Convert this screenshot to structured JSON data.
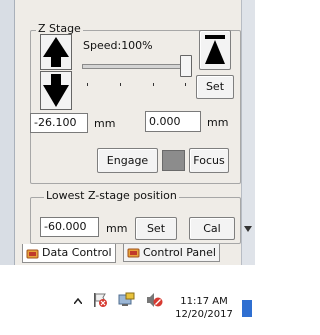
{
  "z_stage": {
    "title": "Z Stage",
    "speed_label": "Speed:100%",
    "speed_percent": 100,
    "set_label": "Set",
    "position_value": "-26.100",
    "position_unit": "mm",
    "target_value": "0.000",
    "target_unit": "mm",
    "engage_label": "Engage",
    "focus_label": "Focus",
    "up_icon": "arrow-up-icon",
    "down_icon": "arrow-down-icon",
    "top_icon": "move-to-top-icon"
  },
  "lowest_position": {
    "title": "Lowest Z-stage position",
    "value": "-60.000",
    "unit": "mm",
    "set_label": "Set",
    "cal_label": "Cal"
  },
  "tabs": [
    {
      "label": "Data Control",
      "icon": "data-control-icon",
      "active": true
    },
    {
      "label": "Control Panel",
      "icon": "control-panel-icon",
      "active": false
    }
  ],
  "taskbar": {
    "time": "11:17 AM",
    "date": "12/20/2017",
    "icons": [
      "chevron-up-icon",
      "flag-icon",
      "network-icon",
      "volume-muted-icon",
      "show-desktop-icon"
    ]
  },
  "colors": {
    "panel_bg": "#efece7",
    "indicator_gray": "#8c8c8c",
    "desktop_blue": "#2f6fd1"
  }
}
